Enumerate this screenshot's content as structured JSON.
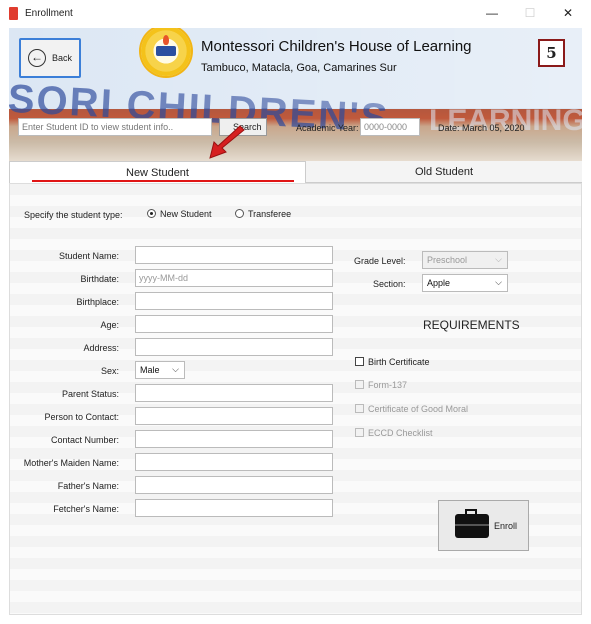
{
  "window": {
    "title": "Enrollment",
    "minimize": "—",
    "maximize": "☐",
    "close": "✕"
  },
  "header": {
    "back_label": "Back",
    "school_name": "Montessori Children's House of Learning",
    "school_address": "Tambuco, Matacla, Goa, Camarines Sur",
    "banner_text": "SSORI CHILDREN'S",
    "banner_text2": "LEARNING",
    "annotation_number": "5"
  },
  "search": {
    "placeholder": "Enter Student ID to view student info..",
    "button_label": "Search",
    "academic_year_label": "Academic Year:",
    "academic_year_value": "0000-0000",
    "date_label": "Date:  March 05, 2020"
  },
  "tabs": [
    {
      "label": "New Student",
      "active": true
    },
    {
      "label": "Old Student",
      "active": false
    }
  ],
  "form": {
    "student_type_label": "Specify the student type:",
    "student_type_options": [
      {
        "label": "New Student",
        "selected": true
      },
      {
        "label": "Transferee",
        "selected": false
      }
    ],
    "fields": [
      {
        "label": "Student Name:",
        "value": ""
      },
      {
        "label": "Birthdate:",
        "value": "yyyy-MM-dd"
      },
      {
        "label": "Birthplace:",
        "value": ""
      },
      {
        "label": "Age:",
        "value": ""
      },
      {
        "label": "Address:",
        "value": ""
      },
      {
        "label": "Sex:",
        "value": "Male"
      },
      {
        "label": "Parent Status:",
        "value": ""
      },
      {
        "label": "Person to Contact:",
        "value": ""
      },
      {
        "label": "Contact Number:",
        "value": ""
      },
      {
        "label": "Mother's Maiden Name:",
        "value": ""
      },
      {
        "label": "Father's Name:",
        "value": ""
      },
      {
        "label": "Fetcher's Name:",
        "value": ""
      }
    ],
    "grade_level_label": "Grade Level:",
    "grade_level_value": "Preschool",
    "section_label": "Section:",
    "section_value": "Apple",
    "requirements_title": "REQUIREMENTS",
    "requirements": [
      {
        "label": "Birth Certificate",
        "enabled": true
      },
      {
        "label": "Form-137",
        "enabled": false
      },
      {
        "label": "Certificate of Good Moral",
        "enabled": false
      },
      {
        "label": "ECCD Checklist",
        "enabled": false
      }
    ],
    "enroll_label": "Enroll"
  },
  "colors": {
    "accent": "#3c7fd8",
    "annotation_red": "#e01515",
    "annotation_border": "#8b1a1a"
  }
}
